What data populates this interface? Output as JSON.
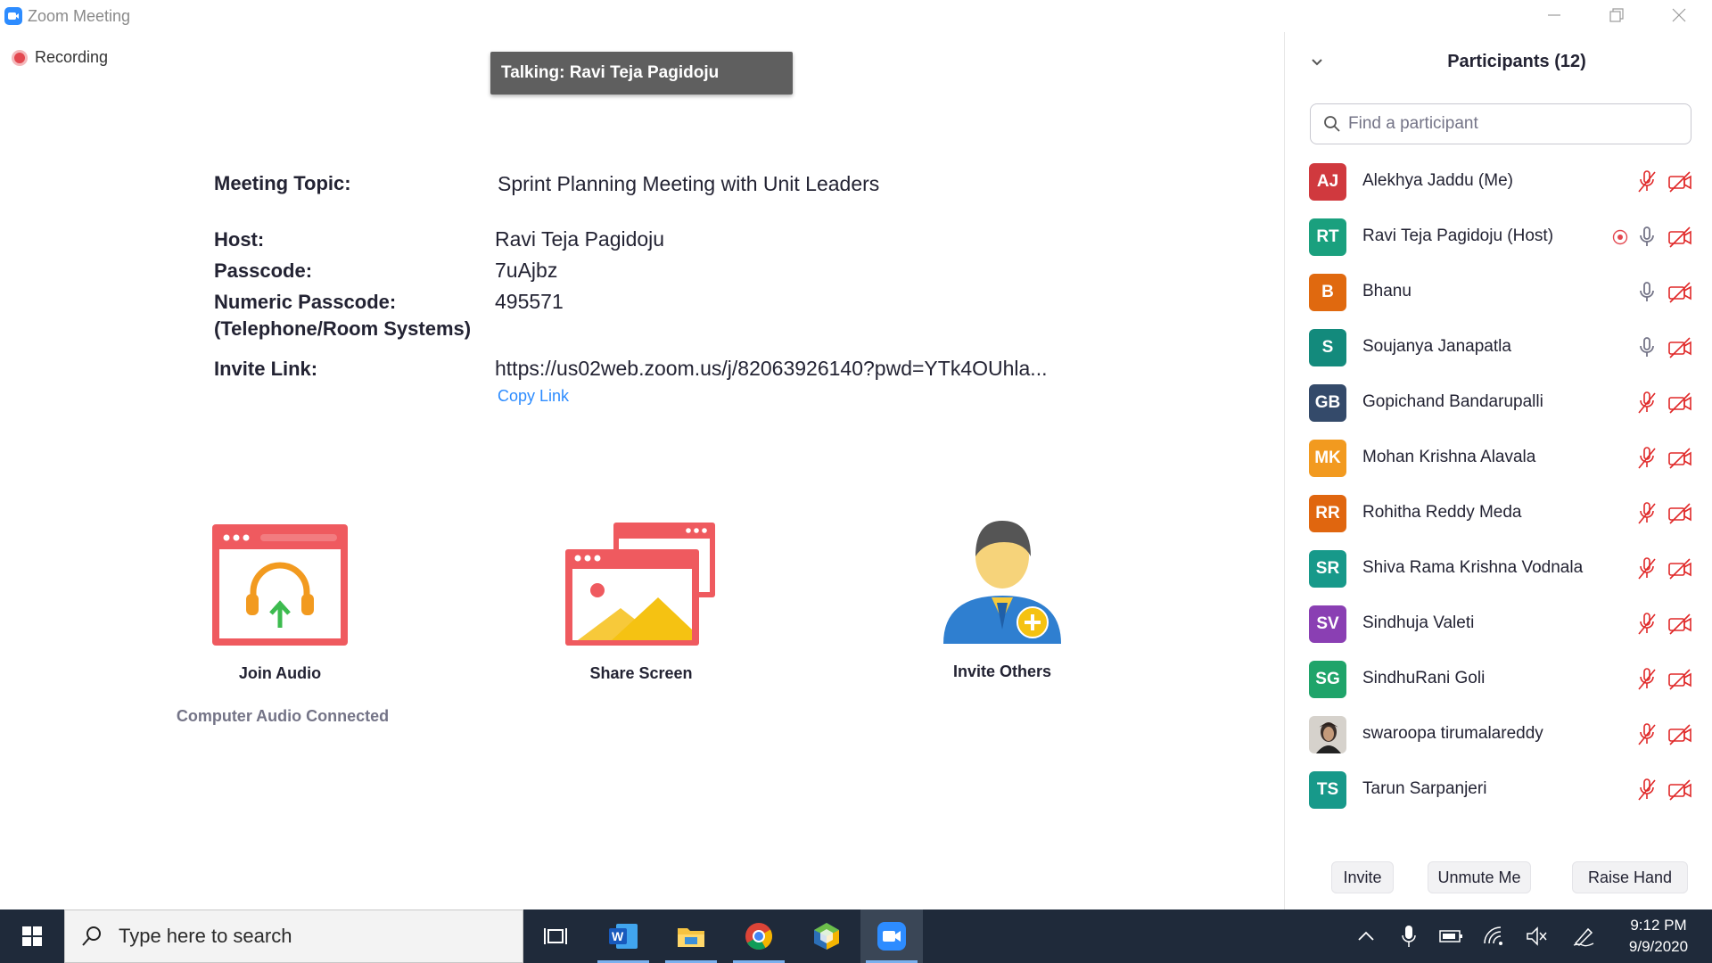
{
  "window": {
    "title": "Zoom Meeting",
    "recording_label": "Recording",
    "talking_banner": "Talking: Ravi Teja Pagidoju"
  },
  "meeting_info": {
    "topic_label": "Meeting Topic:",
    "topic": "Sprint Planning Meeting with Unit Leaders",
    "host_label": "Host:",
    "host": "Ravi Teja Pagidoju",
    "passcode_label": "Passcode:",
    "passcode": "7uAjbz",
    "numeric_passcode_label": "Numeric Passcode:",
    "numeric_passcode_sublabel": "(Telephone/Room Systems)",
    "numeric_passcode": "495571",
    "invite_link_label": "Invite Link:",
    "invite_link": "https://us02web.zoom.us/j/82063926140?pwd=YTk4OUhla...",
    "copy_link_label": "Copy Link"
  },
  "actions": {
    "join_audio": "Join Audio",
    "audio_status": "Computer Audio Connected",
    "share_screen": "Share Screen",
    "invite_others": "Invite Others"
  },
  "participants_panel": {
    "title": "Participants (12)",
    "search_placeholder": "Find a participant",
    "participants": [
      {
        "initials": "AJ",
        "name": "Alekhya Jaddu (Me)",
        "color": "#d0393e",
        "mic": "muted",
        "video": "off",
        "recording": false
      },
      {
        "initials": "RT",
        "name": "Ravi Teja Pagidoju (Host)",
        "color": "#1aa07e",
        "mic": "on",
        "video": "off",
        "recording": true
      },
      {
        "initials": "B",
        "name": "Bhanu",
        "color": "#e0690f",
        "mic": "on",
        "video": "off",
        "recording": false
      },
      {
        "initials": "S",
        "name": "Soujanya Janapatla",
        "color": "#138a7c",
        "mic": "on",
        "video": "off",
        "recording": false
      },
      {
        "initials": "GB",
        "name": "Gopichand Bandarupalli",
        "color": "#344a6a",
        "mic": "muted",
        "video": "off",
        "recording": false
      },
      {
        "initials": "MK",
        "name": "Mohan Krishna Alavala",
        "color": "#f29a1f",
        "mic": "muted",
        "video": "off",
        "recording": false
      },
      {
        "initials": "RR",
        "name": "Rohitha Reddy Meda",
        "color": "#e0660f",
        "mic": "muted",
        "video": "off",
        "recording": false
      },
      {
        "initials": "SR",
        "name": "Shiva Rama Krishna Vodnala",
        "color": "#17998a",
        "mic": "muted",
        "video": "off",
        "recording": false
      },
      {
        "initials": "SV",
        "name": "Sindhuja Valeti",
        "color": "#8a3fb3",
        "mic": "muted",
        "video": "off",
        "recording": false
      },
      {
        "initials": "SG",
        "name": "SindhuRani Goli",
        "color": "#1fa46a",
        "mic": "muted",
        "video": "off",
        "recording": false
      },
      {
        "initials": "",
        "name": "swaroopa tirumalareddy",
        "color": "#d6d2cc",
        "mic": "muted",
        "video": "off",
        "recording": false,
        "photo": true
      },
      {
        "initials": "TS",
        "name": "Tarun Sarpanjeri",
        "color": "#17998a",
        "mic": "muted",
        "video": "off",
        "recording": false
      }
    ],
    "footer": {
      "invite": "Invite",
      "unmute": "Unmute Me",
      "raise_hand": "Raise Hand"
    }
  },
  "taskbar": {
    "search_placeholder": "Type here to search",
    "time": "9:12 PM",
    "date": "9/9/2020"
  }
}
